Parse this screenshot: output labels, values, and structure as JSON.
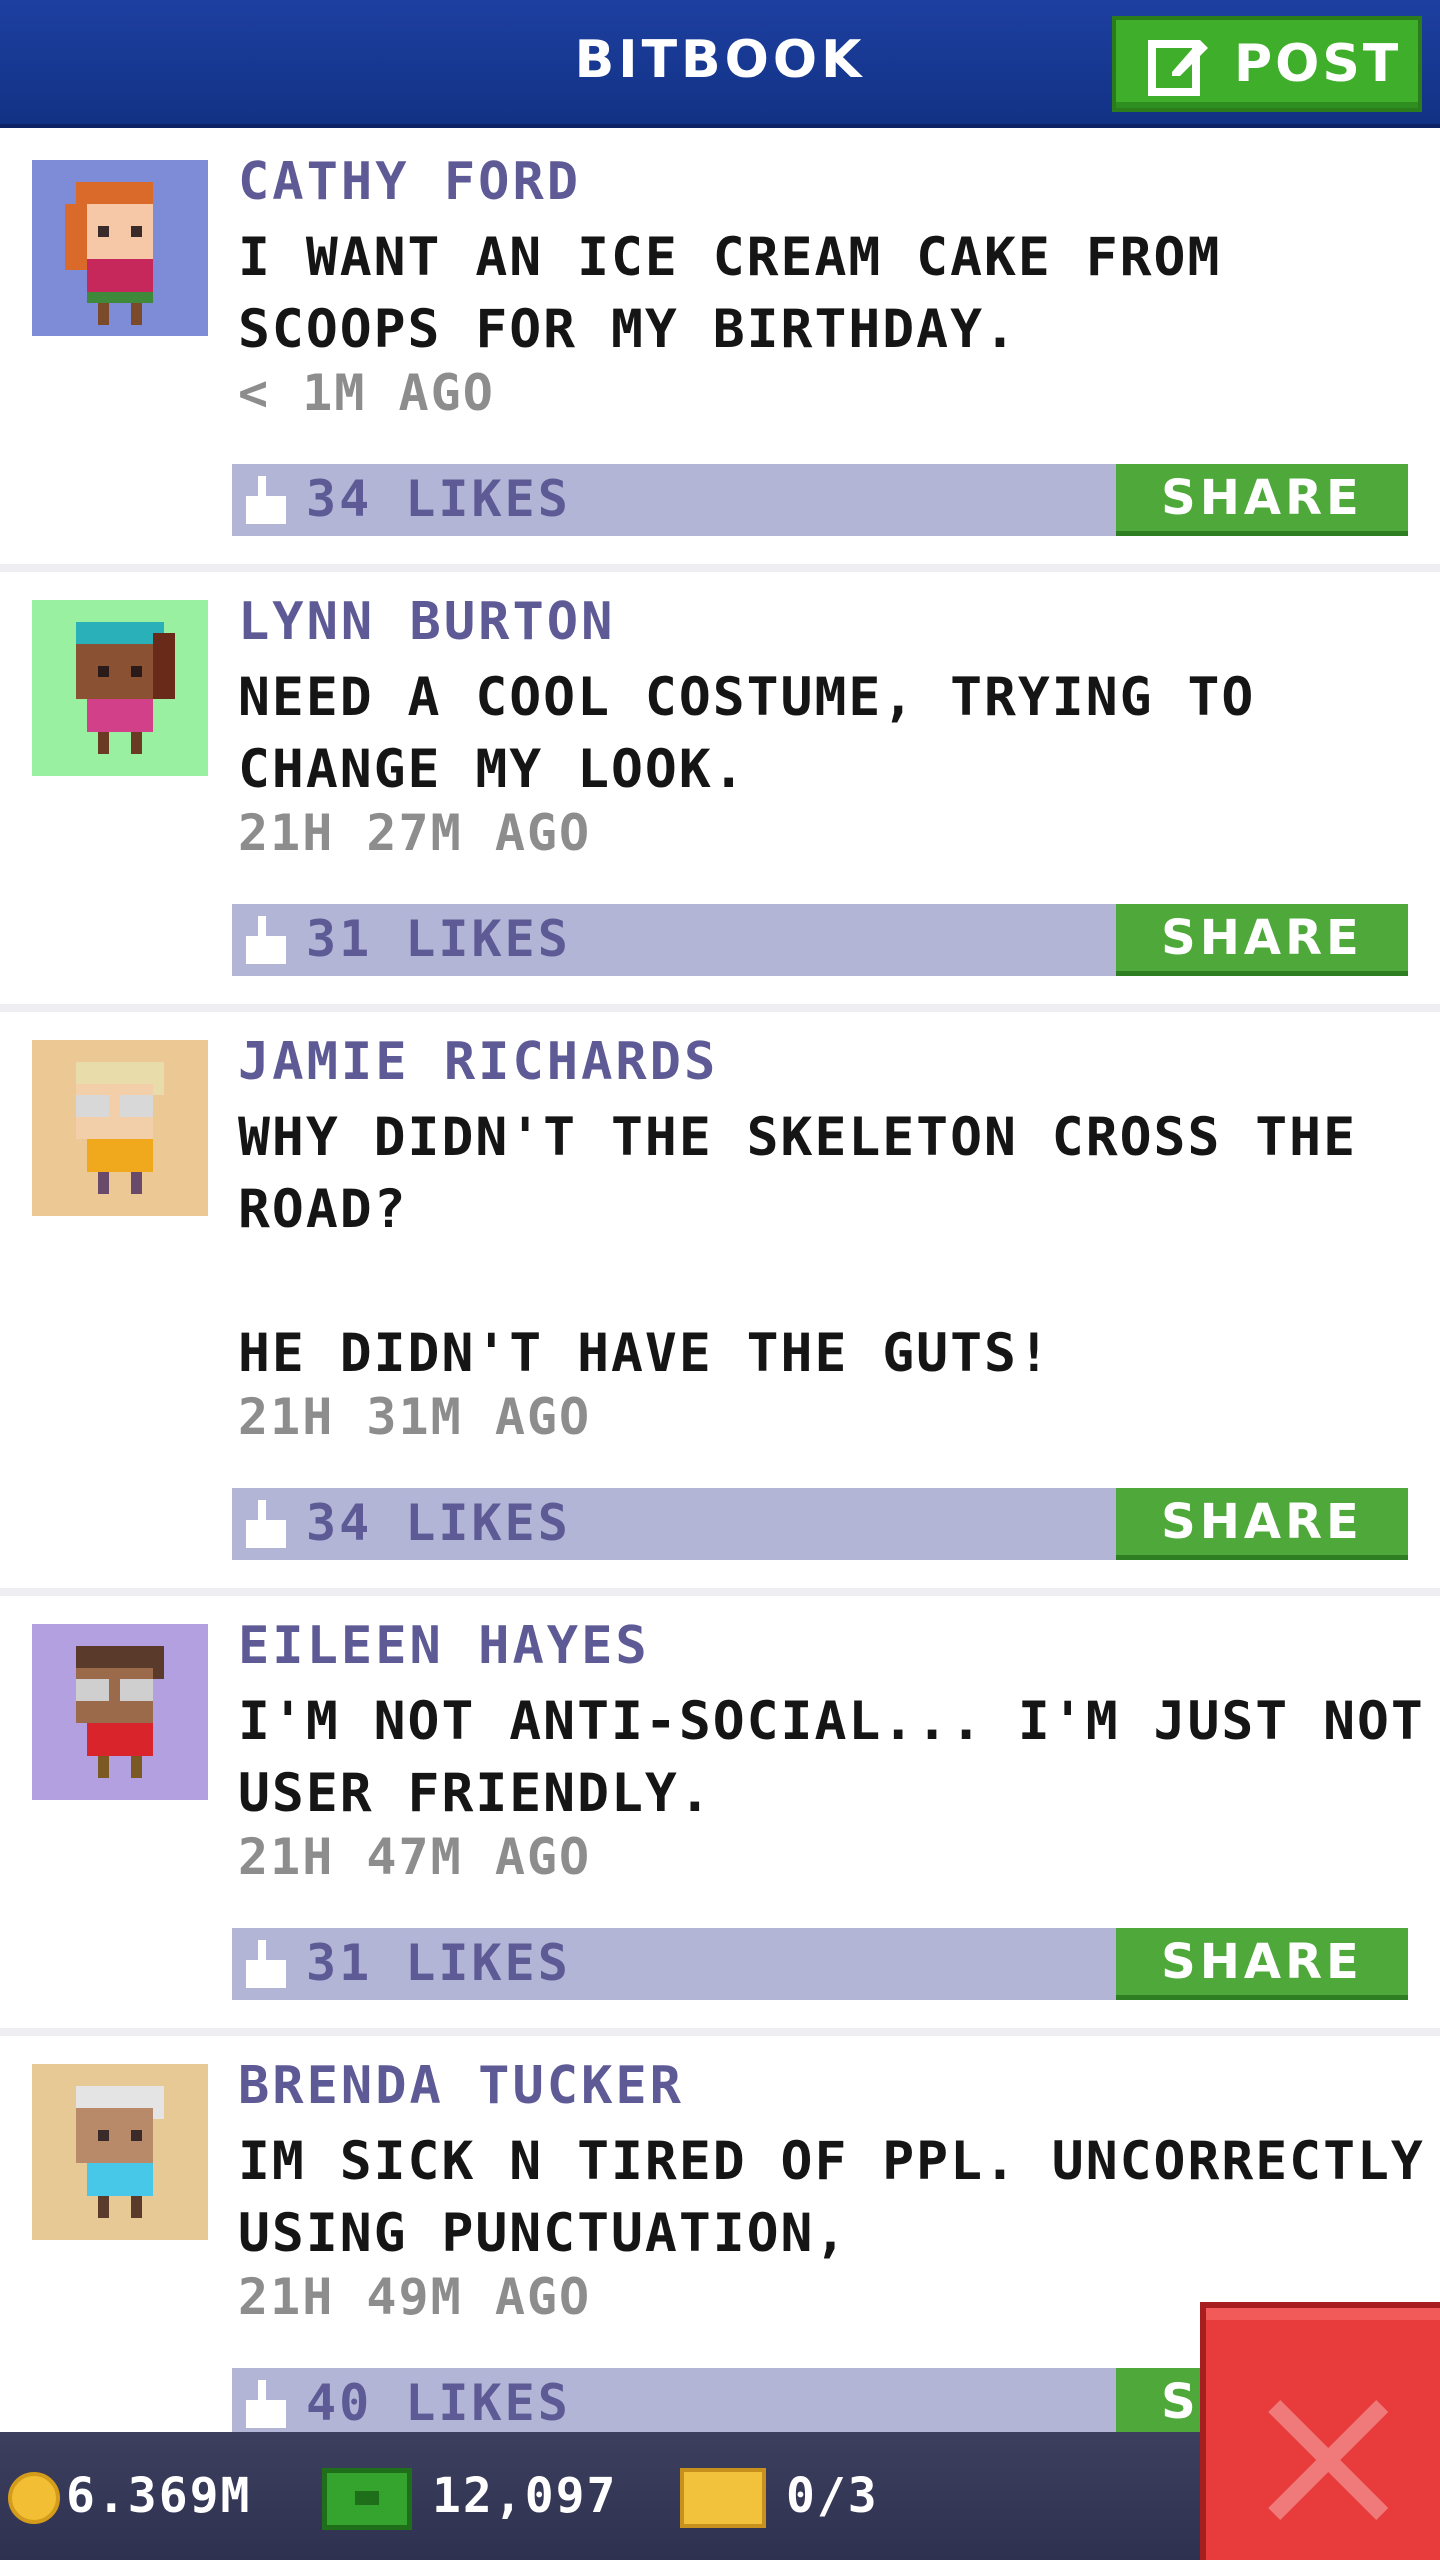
{
  "header": {
    "title": "BITBOOK",
    "post_label": "POST"
  },
  "posts": [
    {
      "author": "CATHY FORD",
      "text": "I WANT AN ICE CREAM CAKE FROM\nSCOOPS FOR MY BIRTHDAY.",
      "time": "< 1M AGO",
      "likes": "34 LIKES",
      "share_label": "SHARE",
      "avatar_bg": "#7e8bd6"
    },
    {
      "author": "LYNN BURTON",
      "text": "NEED A COOL COSTUME, TRYING TO\nCHANGE MY LOOK.",
      "time": "21H 27M AGO",
      "likes": "31 LIKES",
      "share_label": "SHARE",
      "avatar_bg": "#98f0a0"
    },
    {
      "author": "JAMIE RICHARDS",
      "text": "WHY DIDN'T THE SKELETON CROSS THE\nROAD?\n\nHE DIDN'T HAVE THE GUTS!",
      "time": "21H 31M AGO",
      "likes": "34 LIKES",
      "share_label": "SHARE",
      "avatar_bg": "#ecc994"
    },
    {
      "author": "EILEEN HAYES",
      "text": "I'M NOT ANTI-SOCIAL... I'M JUST NOT\nUSER FRIENDLY.",
      "time": "21H 47M AGO",
      "likes": "31 LIKES",
      "share_label": "SHARE",
      "avatar_bg": "#b3a0e0"
    },
    {
      "author": "BRENDA TUCKER",
      "text": "IM SICK N TIRED OF PPL. UNCORRECTLY\nUSING PUNCTUATION,",
      "time": "21H 49M AGO",
      "likes": "40 LIKES",
      "share_label": "SHARE",
      "avatar_bg": "#e6c994"
    }
  ],
  "status_bar": {
    "coins": "6.369M",
    "bux": "12,097",
    "tickets": "0/3"
  },
  "icons": {
    "post": "edit-icon",
    "like": "thumb-icon",
    "coin": "coin-icon",
    "bux": "bux-icon",
    "ticket": "ticket-icon",
    "close": "close-icon"
  },
  "colors": {
    "header": "#1a3a96",
    "green_button": "#4ea83a",
    "like_bar": "#b3b5d6",
    "author": "#5e5a96",
    "close_button": "#e83c3c"
  }
}
